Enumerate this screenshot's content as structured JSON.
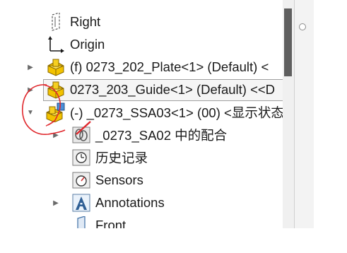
{
  "tree": {
    "items": [
      {
        "label": "Right",
        "icon": "plane-icon"
      },
      {
        "label": "Origin",
        "icon": "origin-icon"
      },
      {
        "label": "(f) 0273_202_Plate<1> (Default) <",
        "icon": "part-icon",
        "expander": "▶"
      },
      {
        "label": "0273_203_Guide<1> (Default) <<D",
        "icon": "part-icon",
        "expander": "▶"
      },
      {
        "label": "(-) _0273_SSA03<1> (00) <显示状态",
        "icon": "subassembly-icon",
        "expander": "▼"
      },
      {
        "label": "_0273_SA02 中的配合",
        "icon": "mates-folder-icon",
        "expander": "▶"
      },
      {
        "label": "历史记录",
        "icon": "history-icon"
      },
      {
        "label": "Sensors",
        "icon": "sensors-icon"
      },
      {
        "label": "Annotations",
        "icon": "annotations-icon",
        "expander": "▶"
      },
      {
        "label": "Front",
        "icon": "plane-icon"
      }
    ]
  },
  "colors": {
    "part_yellow": "#f2c200",
    "annotation_red": "#e0282d",
    "scroll_thumb": "#5f5f5f"
  }
}
